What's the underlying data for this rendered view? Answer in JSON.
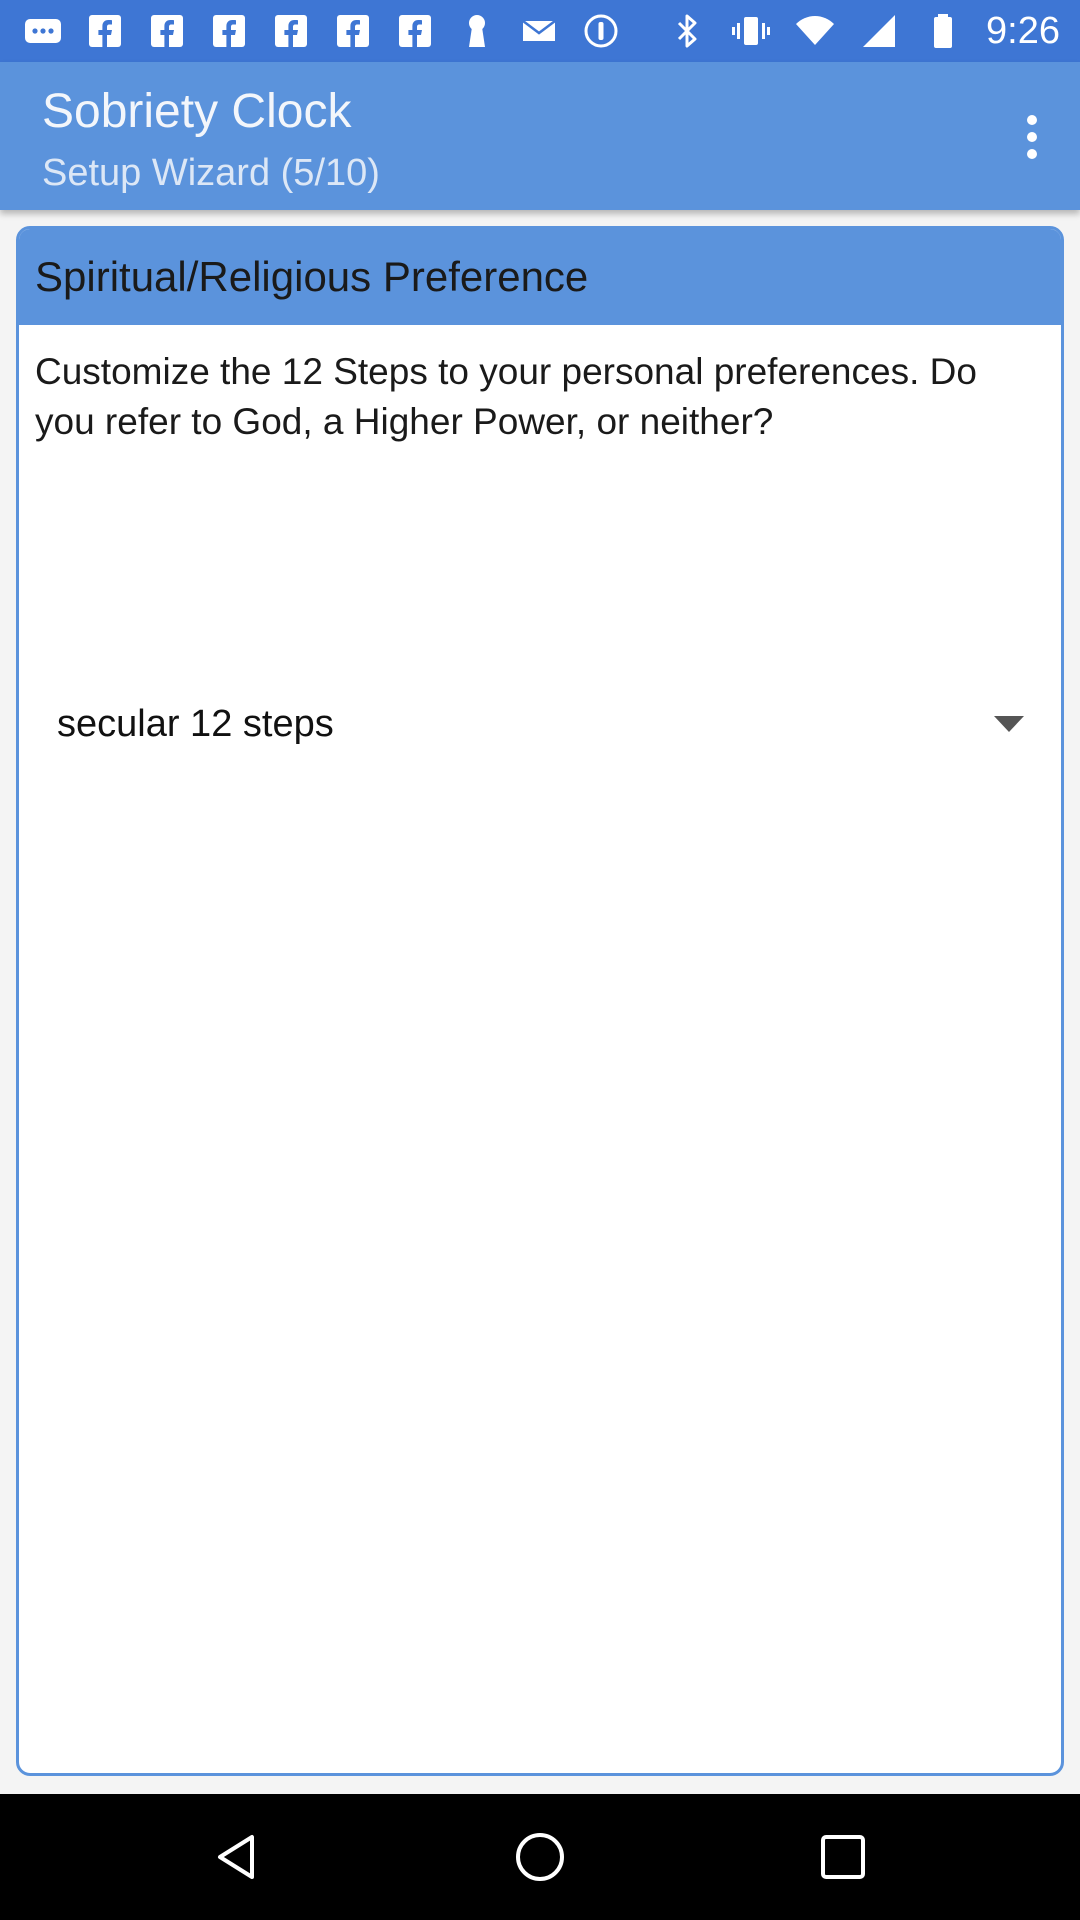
{
  "status_bar": {
    "time": "9:26",
    "left_icons": [
      "messaging-icon",
      "facebook-icon",
      "facebook-icon",
      "facebook-icon",
      "facebook-icon",
      "facebook-icon",
      "facebook-icon",
      "keyhole-icon",
      "email-icon",
      "info-circle-icon"
    ],
    "right_icons": [
      "bluetooth-icon",
      "vibrate-icon",
      "wifi-icon",
      "signal-icon",
      "battery-icon"
    ]
  },
  "app_bar": {
    "title": "Sobriety Clock",
    "subtitle": "Setup Wizard (5/10)",
    "overflow_icon": "more-vertical-icon"
  },
  "card": {
    "title": "Spiritual/Religious Preference",
    "description": "Customize the 12 Steps to your personal preferences. Do you refer to God, a Higher Power, or neither?",
    "spinner": {
      "selected_value": "secular 12 steps",
      "icon": "dropdown-arrow-icon"
    }
  },
  "nav_bar": {
    "icons": [
      "back-icon",
      "home-icon",
      "recents-icon"
    ]
  },
  "colors": {
    "status_bar": "#3e76d4",
    "app_bar": "#5b93dc",
    "card_border": "#5b93dc"
  }
}
